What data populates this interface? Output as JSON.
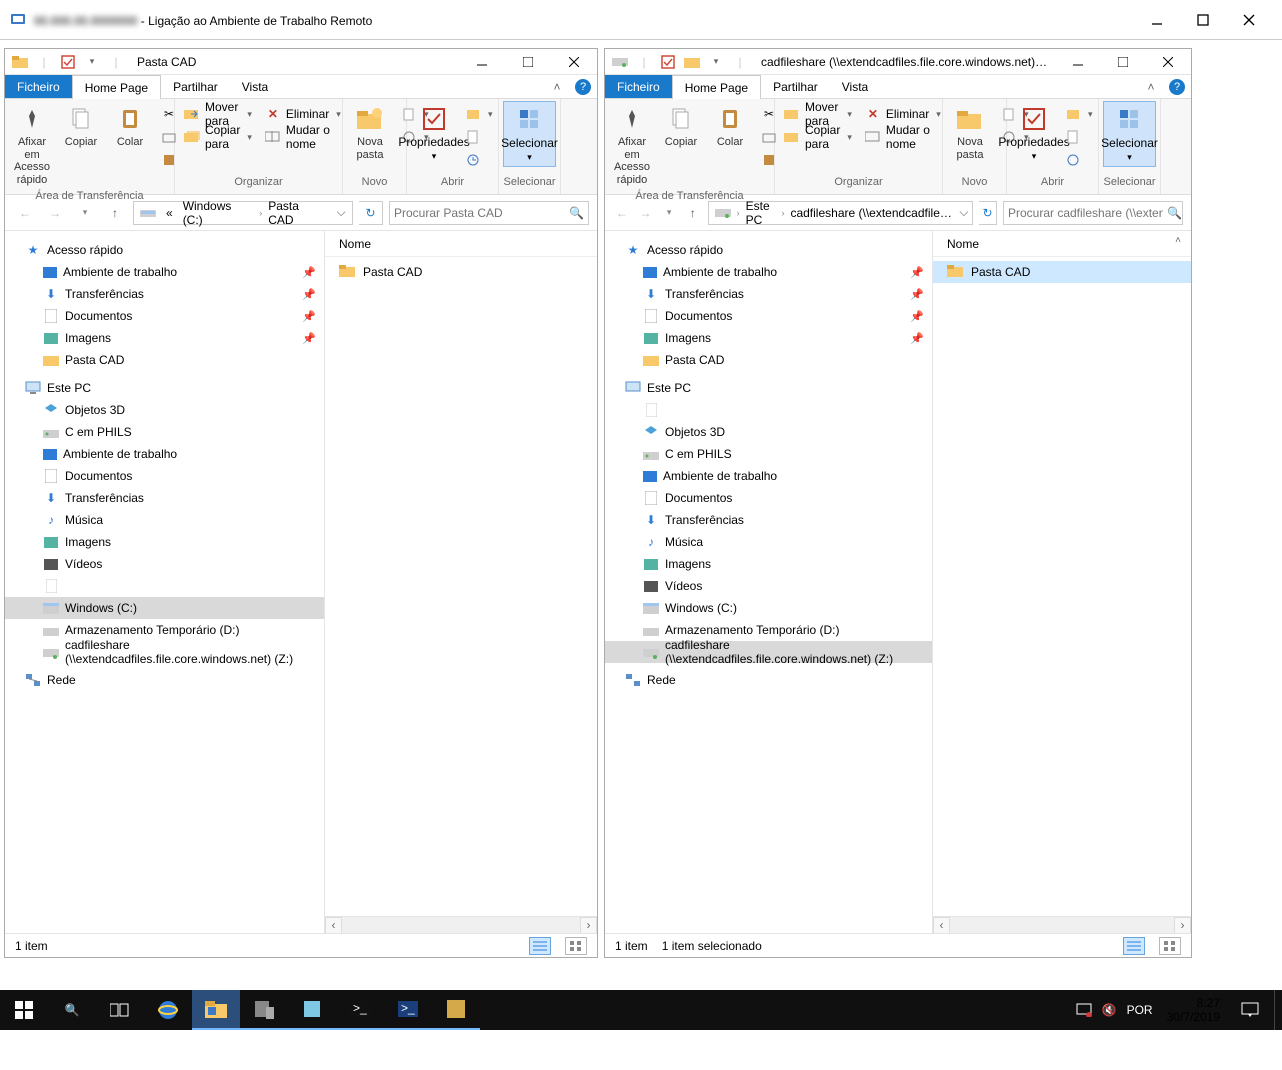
{
  "rdp": {
    "title_suffix": " - Ligação ao Ambiente de Trabalho Remoto"
  },
  "explorers": [
    {
      "title": "Pasta CAD",
      "tabs": {
        "file": "Ficheiro",
        "home": "Home Page",
        "share": "Partilhar",
        "view": "Vista"
      },
      "ribbon": {
        "clipboard": {
          "pin": "Afixar em Acesso rápido",
          "copy": "Copiar",
          "paste": "Colar",
          "label": "Área de Transferência"
        },
        "organize": {
          "move": "Mover para",
          "copyto": "Copiar para",
          "delete": "Eliminar",
          "rename": "Mudar o nome",
          "label": "Organizar"
        },
        "new": {
          "newfolder": "Nova pasta",
          "label": "Novo"
        },
        "open": {
          "properties": "Propriedades",
          "label": "Abrir"
        },
        "select": {
          "select": "Selecionar",
          "label": "Selecionar"
        }
      },
      "breadcrumb": {
        "a": "«",
        "b": "Windows (C:)",
        "c": "Pasta CAD"
      },
      "search": {
        "placeholder": "Procurar Pasta CAD"
      },
      "list_header": "Nome",
      "list_items": [
        {
          "name": "Pasta CAD"
        }
      ],
      "tree": {
        "quick": {
          "root": "Acesso rápido",
          "items": [
            "Ambiente de trabalho",
            "Transferências",
            "Documentos",
            "Imagens",
            "Pasta CAD"
          ]
        },
        "pc": {
          "root": "Este PC",
          "items": [
            "Objetos 3D",
            "C em PHILS",
            "Ambiente de trabalho",
            "Documentos",
            "Transferências",
            "Música",
            "Imagens",
            "Vídeos",
            "",
            "Windows (C:)",
            "Armazenamento Temporário (D:)",
            "cadfileshare (\\\\extendcadfiles.file.core.windows.net) (Z:)"
          ]
        },
        "network": "Rede"
      },
      "status": {
        "count": "1 item"
      }
    },
    {
      "title": "cadfileshare (\\\\extendcadfiles.file.core.windows.net) (Z:)",
      "tabs": {
        "file": "Ficheiro",
        "home": "Home Page",
        "share": "Partilhar",
        "view": "Vista"
      },
      "ribbon": {
        "clipboard": {
          "pin": "Afixar em Acesso rápido",
          "copy": "Copiar",
          "paste": "Colar",
          "label": "Área de Transferência"
        },
        "organize": {
          "move": "Mover para",
          "copyto": "Copiar para",
          "delete": "Eliminar",
          "rename": "Mudar o nome",
          "label": "Organizar"
        },
        "new": {
          "newfolder": "Nova pasta",
          "label": "Novo"
        },
        "open": {
          "properties": "Propriedades",
          "label": "Abrir"
        },
        "select": {
          "select": "Selecionar",
          "label": "Selecionar"
        }
      },
      "breadcrumb": {
        "a": "Este PC",
        "b": "cadfileshare (\\\\extendcadfile…"
      },
      "search": {
        "placeholder": "Procurar cadfileshare (\\\\extendcadfiles…"
      },
      "list_header": "Nome",
      "list_items": [
        {
          "name": "Pasta CAD"
        }
      ],
      "tree": {
        "quick": {
          "root": "Acesso rápido",
          "items": [
            "Ambiente de trabalho",
            "Transferências",
            "Documentos",
            "Imagens",
            "Pasta CAD"
          ]
        },
        "pc": {
          "root": "Este PC",
          "items": [
            "",
            "Objetos 3D",
            "C em PHILS",
            "Ambiente de trabalho",
            "Documentos",
            "Transferências",
            "Música",
            "Imagens",
            "Vídeos",
            "Windows (C:)",
            "Armazenamento Temporário (D:)",
            "cadfileshare (\\\\extendcadfiles.file.core.windows.net) (Z:)"
          ]
        },
        "network": "Rede"
      },
      "status": {
        "count": "1 item",
        "selected": "1 item selecionado"
      }
    }
  ],
  "taskbar": {
    "lang": "POR",
    "time": "8:27",
    "date": "30/7/2019"
  }
}
